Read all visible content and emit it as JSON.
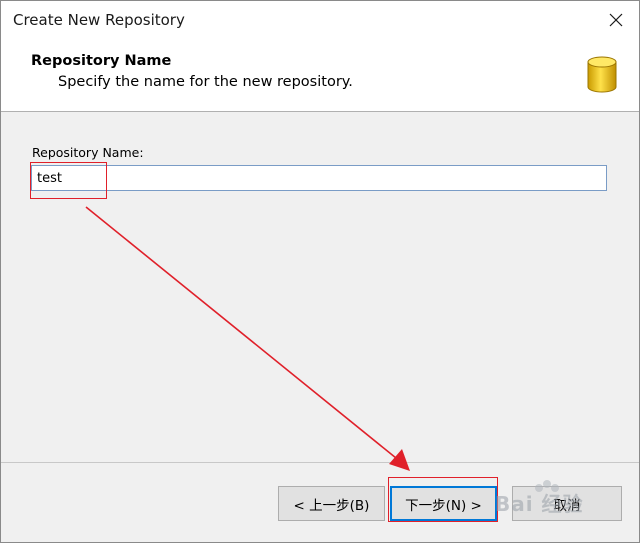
{
  "window": {
    "title": "Create New Repository"
  },
  "header": {
    "title": "Repository Name",
    "subtitle": "Specify the name for the new repository.",
    "icon": "database-icon"
  },
  "form": {
    "label": "Repository Name:",
    "value": "test"
  },
  "buttons": {
    "back": "< 上一步(B)",
    "next": "下一步(N) >",
    "cancel": "取消"
  },
  "watermark": {
    "text": "Bai 经验"
  },
  "colors": {
    "annotation": "#e0202a",
    "focus_border": "#0078d7",
    "icon_gold": "#f2c200"
  }
}
